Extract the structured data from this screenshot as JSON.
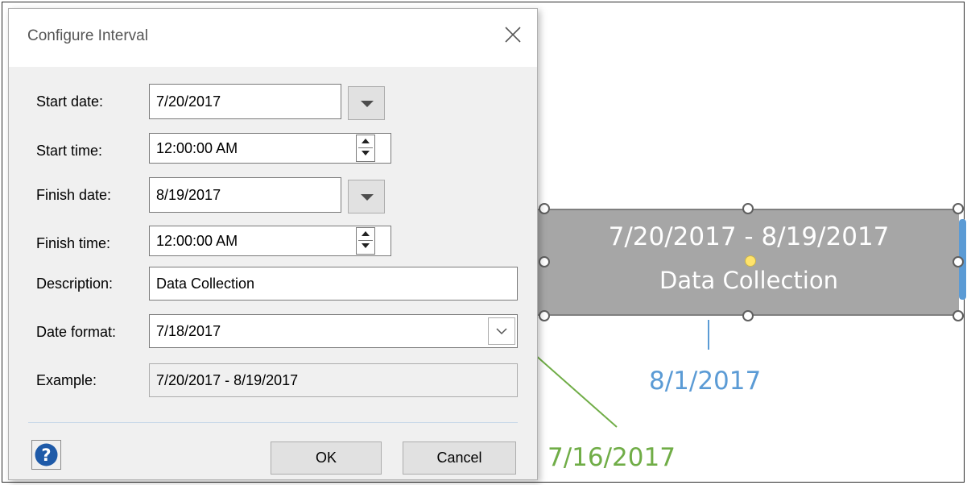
{
  "dialog": {
    "title": "Configure Interval",
    "fields": {
      "start_date": {
        "label": "Start date:",
        "value": "7/20/2017"
      },
      "start_time": {
        "label": "Start time:",
        "value": "12:00:00 AM"
      },
      "finish_date": {
        "label": "Finish date:",
        "value": "8/19/2017"
      },
      "finish_time": {
        "label": "Finish time:",
        "value": "12:00:00 AM"
      },
      "description": {
        "label": "Description:",
        "value": "Data Collection"
      },
      "date_format": {
        "label": "Date format:",
        "value": "7/18/2017"
      },
      "example": {
        "label": "Example:",
        "value": "7/20/2017 - 8/19/2017"
      }
    },
    "buttons": {
      "ok": "OK",
      "cancel": "Cancel"
    },
    "icons": {
      "close": "close-icon",
      "help": "help-icon"
    }
  },
  "canvas": {
    "interval_shape": {
      "range_text": "7/20/2017 - 8/19/2017",
      "description_text": "Data Collection"
    },
    "milestone_blue": "8/1/2017",
    "milestone_green": "7/16/2017",
    "colors": {
      "blue": "#5b9bd5",
      "green": "#70ad47",
      "shape_fill": "#a6a6a6"
    }
  }
}
